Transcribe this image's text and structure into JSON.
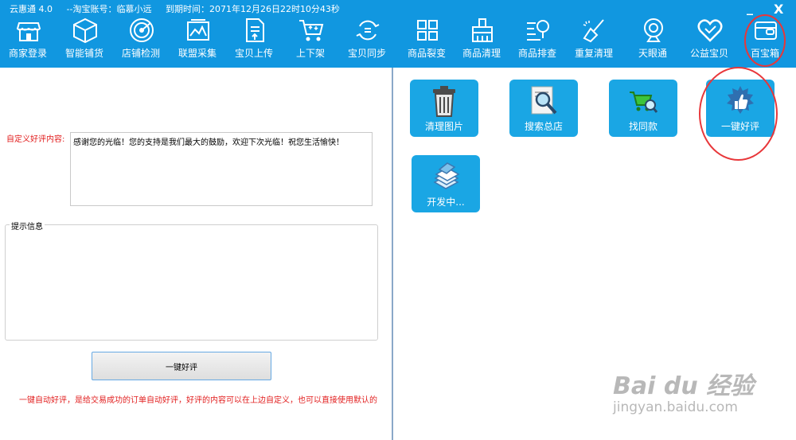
{
  "title_bar": {
    "app_name": "云惠通  4.0",
    "account": "--淘宝账号：临慕小远",
    "expiry": "到期时间：2071年12月26日22时10分43秒",
    "minimize": "_",
    "close": "X"
  },
  "toolbar": [
    {
      "label": "商家登录",
      "icon": "store-icon"
    },
    {
      "label": "智能铺货",
      "icon": "box-icon"
    },
    {
      "label": "店铺检测",
      "icon": "radar-icon"
    },
    {
      "label": "联盟采集",
      "icon": "image-collect-icon"
    },
    {
      "label": "宝贝上传",
      "icon": "upload-icon"
    },
    {
      "label": "上下架",
      "icon": "cart-icon"
    },
    {
      "label": "宝贝同步",
      "icon": "sync-icon"
    },
    {
      "label": "商品裂变",
      "icon": "grid-icon"
    },
    {
      "label": "商品清理",
      "icon": "brush-icon"
    },
    {
      "label": "商品排查",
      "icon": "search-list-icon"
    },
    {
      "label": "重复清理",
      "icon": "broom-icon"
    },
    {
      "label": "天眼通",
      "icon": "webcam-icon"
    },
    {
      "label": "公益宝贝",
      "icon": "heart-icon"
    },
    {
      "label": "百宝箱",
      "icon": "wallet-icon"
    }
  ],
  "left": {
    "custom_label": "自定义好评内容:",
    "custom_text": "感谢您的光临！您的支持是我们最大的鼓励，欢迎下次光临！祝您生活愉快！",
    "hint_title": "提示信息",
    "one_key_button": "一键好评",
    "note": "一键自动好评，是给交易成功的订单自动好评，好评的内容可以在上边自定义，也可以直接使用默认的"
  },
  "tiles": [
    {
      "label": "清理图片",
      "icon": "trash-icon"
    },
    {
      "label": "搜索总店",
      "icon": "magnifier-doc-icon"
    },
    {
      "label": "找同款",
      "icon": "cart-search-icon"
    },
    {
      "label": "一键好评",
      "icon": "thumbs-up-icon"
    },
    {
      "label": "开发中...",
      "icon": "stack-papers-icon"
    }
  ],
  "watermark": {
    "main": "Bai du 经验",
    "sub": "jingyan.baidu.com"
  },
  "colors": {
    "topbar": "#1197e0",
    "tile": "#1aa6e4",
    "highlight": "#e8373a",
    "note_red": "#e22020"
  }
}
